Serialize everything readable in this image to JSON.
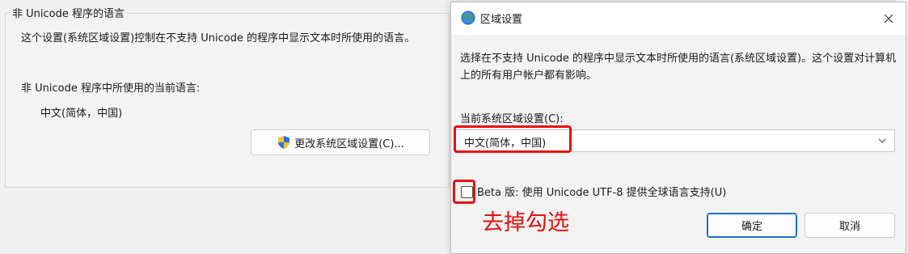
{
  "background_panel": {
    "group_title": "非 Unicode 程序的语言",
    "description": "这个设置(系统区域设置)控制在不支持 Unicode 的程序中显示文本时所使用的语言。",
    "current_label": "非 Unicode 程序中所使用的当前语言:",
    "current_value": "中文(简体，中国)",
    "change_button_label": "更改系统区域设置(C)..."
  },
  "dialog": {
    "title": "区域设置",
    "description": "选择在不支持 Unicode 的程序中显示文本时所使用的语言(系统区域设置)。这个设置对计算机上的所有用户帐户都有影响。",
    "locale_label": "当前系统区域设置(C):",
    "locale_selected": "中文(简体，中国)",
    "beta_checkbox_label": "Beta 版: 使用 Unicode UTF-8 提供全球语言支持(U)",
    "beta_checked": false,
    "annotation_text": "去掉勾选",
    "ok_label": "确定",
    "cancel_label": "取消"
  },
  "icons": {
    "title": "globe-icon",
    "change_button": "uac-shield-icon",
    "close": "close-icon",
    "select": "chevron-down-icon"
  },
  "colors": {
    "highlight": "#e81010",
    "primary_border": "#1c6fc6"
  }
}
